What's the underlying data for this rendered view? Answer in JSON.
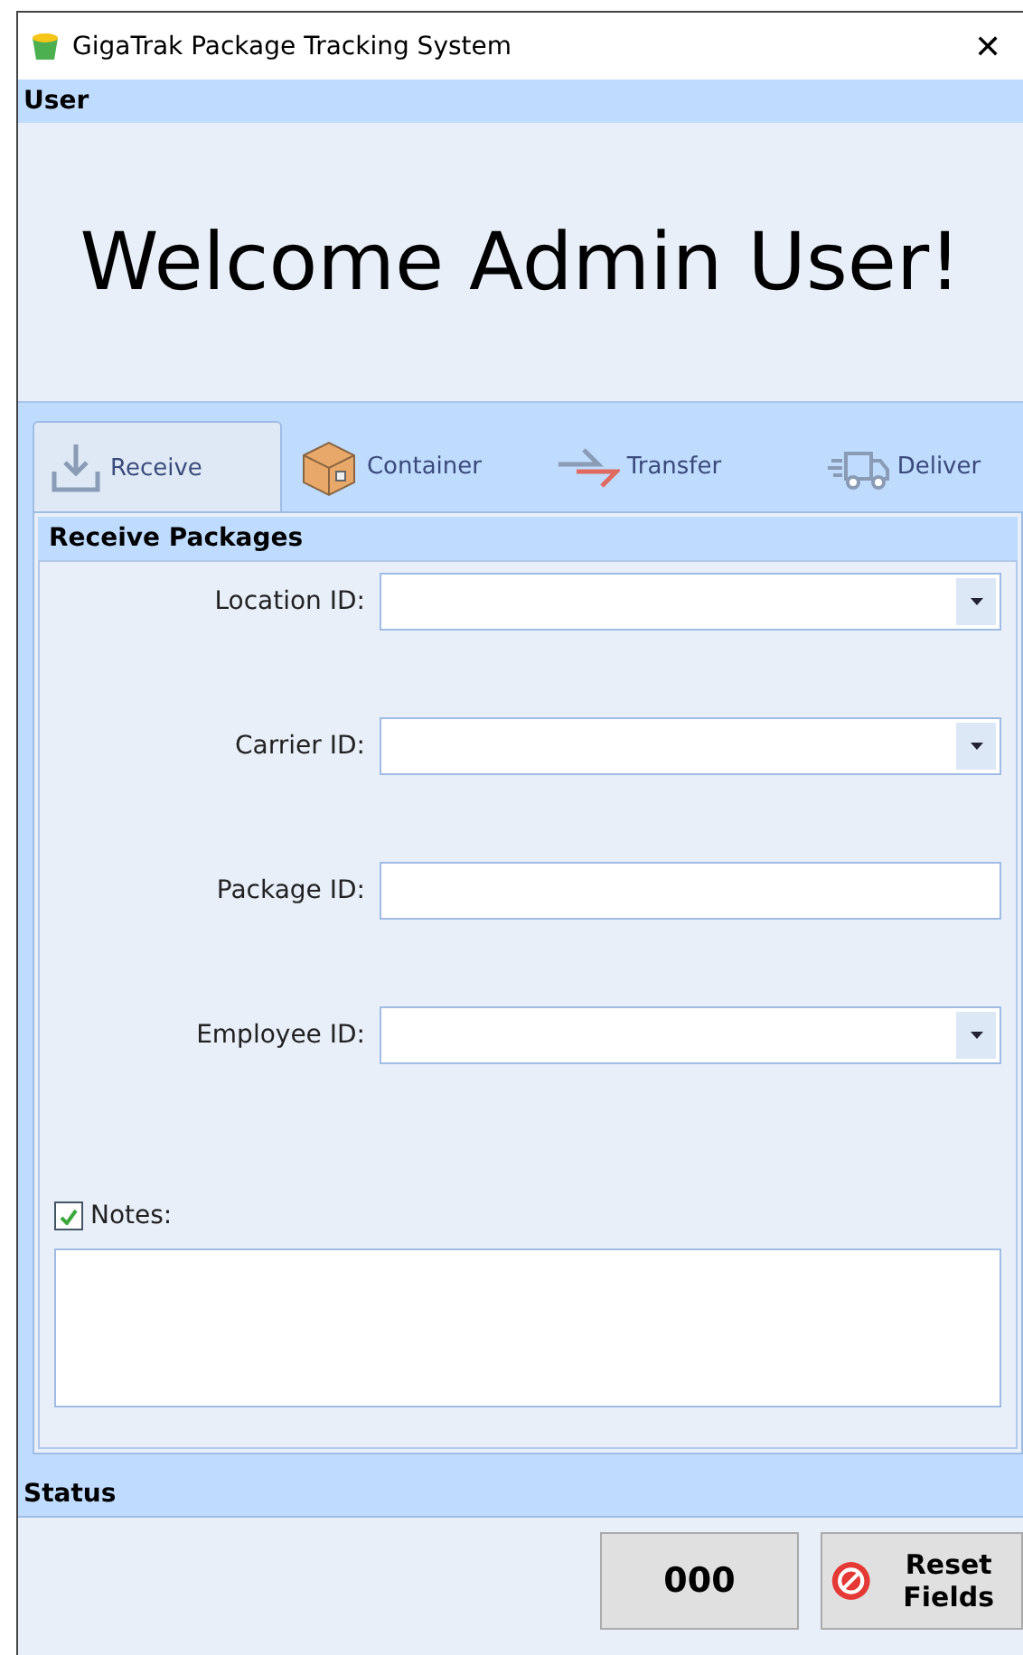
{
  "window": {
    "title": "GigaTrak Package Tracking System",
    "close": "✕"
  },
  "user_section": {
    "header": "User",
    "welcome": "Welcome Admin User!"
  },
  "tabs": [
    {
      "label": "Receive",
      "selected": true
    },
    {
      "label": "Container",
      "selected": false
    },
    {
      "label": "Transfer",
      "selected": false
    },
    {
      "label": "Deliver",
      "selected": false
    }
  ],
  "form": {
    "header": "Receive Packages",
    "fields": [
      {
        "label": "Location ID:",
        "kind": "dropdown"
      },
      {
        "label": "Carrier ID:",
        "kind": "dropdown"
      },
      {
        "label": "Package ID:",
        "kind": "text"
      },
      {
        "label": "Employee ID:",
        "kind": "dropdown"
      }
    ],
    "notes": {
      "label": "Notes:",
      "checked": true
    }
  },
  "status": {
    "header": "Status",
    "counter": "000",
    "reset_button": "Reset Fields"
  }
}
